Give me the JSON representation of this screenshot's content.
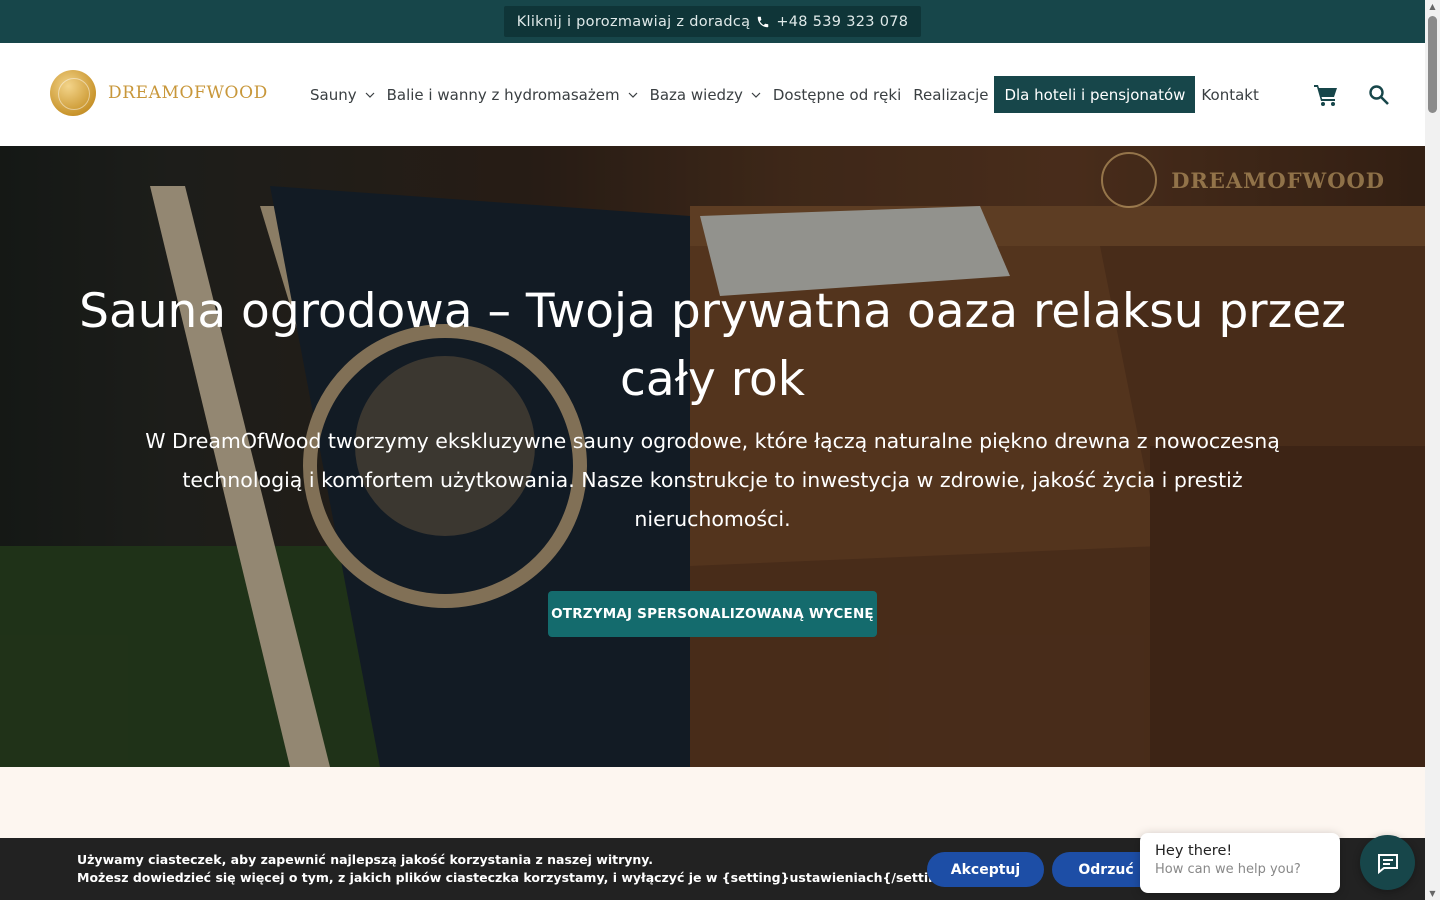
{
  "topbar": {
    "text": "Kliknij i porozmawiaj z doradcą",
    "phone": "+48 539 323 078",
    "icon": "phone-icon"
  },
  "header": {
    "logo_text": "DREAMOFWOOD",
    "nav": [
      {
        "label": "Sauny",
        "dropdown": true
      },
      {
        "label": "Balie i wanny z hydromasażem",
        "dropdown": true
      },
      {
        "label": "Baza wiedzy",
        "dropdown": true
      },
      {
        "label": "Dostępne od ręki",
        "dropdown": false
      },
      {
        "label": "Realizacje",
        "dropdown": false
      },
      {
        "label": "Dla hoteli i pensjonatów",
        "dropdown": false,
        "highlight": true
      },
      {
        "label": "Kontakt",
        "dropdown": false
      }
    ],
    "icons": [
      "cart-icon",
      "search-icon"
    ]
  },
  "hero": {
    "watermark": "DREAMOFWOOD",
    "title": "Sauna ogrodowa – Twoja prywatna oaza relaksu przez cały rok",
    "text": "W DreamOfWood tworzymy ekskluzywne sauny ogrodowe, które łączą naturalne piękno drewna z nowoczesną technologią i komfortem użytkowania. Nasze konstrukcje to inwestycja w zdrowie, jakość życia i prestiż nieruchomości.",
    "cta": "OTRZYMAJ SPERSONALIZOWANĄ WYCENĘ"
  },
  "cookie": {
    "line1": "Używamy ciasteczek, aby zapewnić najlepszą jakość korzystania z naszej witryny.",
    "line2": "Możesz dowiedzieć się więcej o tym, z jakich plików ciasteczka korzystamy, i wyłączyć je w {setting}ustawieniach{/setting}.",
    "accept": "Akceptuj",
    "reject": "Odrzuć"
  },
  "chat": {
    "title": "Hey there!",
    "subtitle": "How can we help you?",
    "icon": "chat-icon"
  },
  "colors": {
    "brand_dark": "#17464a",
    "cta_teal": "#146b6d",
    "cookie_button": "#1d4ea6",
    "logo_gold": "#c8973a"
  }
}
